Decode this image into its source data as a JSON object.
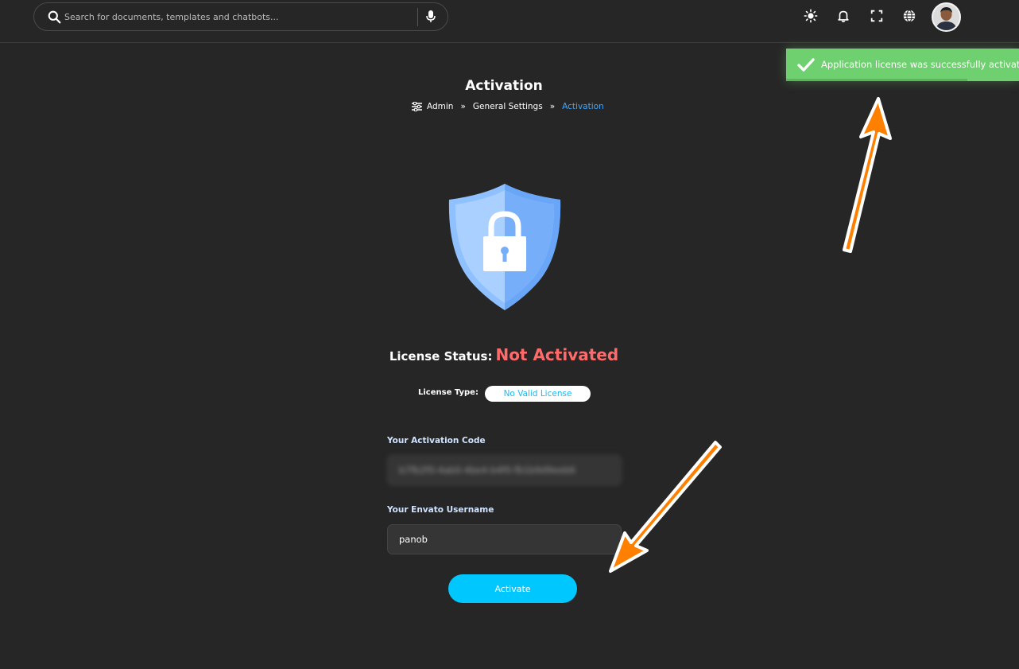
{
  "search": {
    "placeholder": "Search for documents, templates and chatbots..."
  },
  "toast": {
    "message": "Application license was successfully activated"
  },
  "page": {
    "title": "Activation"
  },
  "breadcrumb": {
    "items": [
      "Admin",
      "General Settings",
      "Activation"
    ],
    "separator": "»"
  },
  "license": {
    "status_label": "License Status:",
    "status_value": "Not Activated",
    "type_label": "License Type:",
    "type_value": "No Valid License"
  },
  "form": {
    "activation_code_label": "Your Activation Code",
    "activation_code_value": "b7fb2f0-4ab0-4be4-b4f0-fb1b9d9eeb6",
    "username_label": "Your Envato Username",
    "username_value": "panob",
    "submit_label": "Activate"
  },
  "colors": {
    "background": "#262626",
    "accent": "#00c8ff",
    "error": "#ff6b6b",
    "success": "#6fd06f",
    "breadcrumb_active": "#3ea8ff",
    "annotation_arrow": "#ff7f00"
  },
  "icons": {
    "search": "search-icon",
    "mic": "microphone-icon",
    "theme": "sun-icon",
    "notifications": "bell-icon",
    "fullscreen": "fullscreen-icon",
    "language": "globe-icon",
    "toast": "check-icon",
    "breadcrumb": "sliders-icon",
    "hero": "shield-lock-icon"
  }
}
